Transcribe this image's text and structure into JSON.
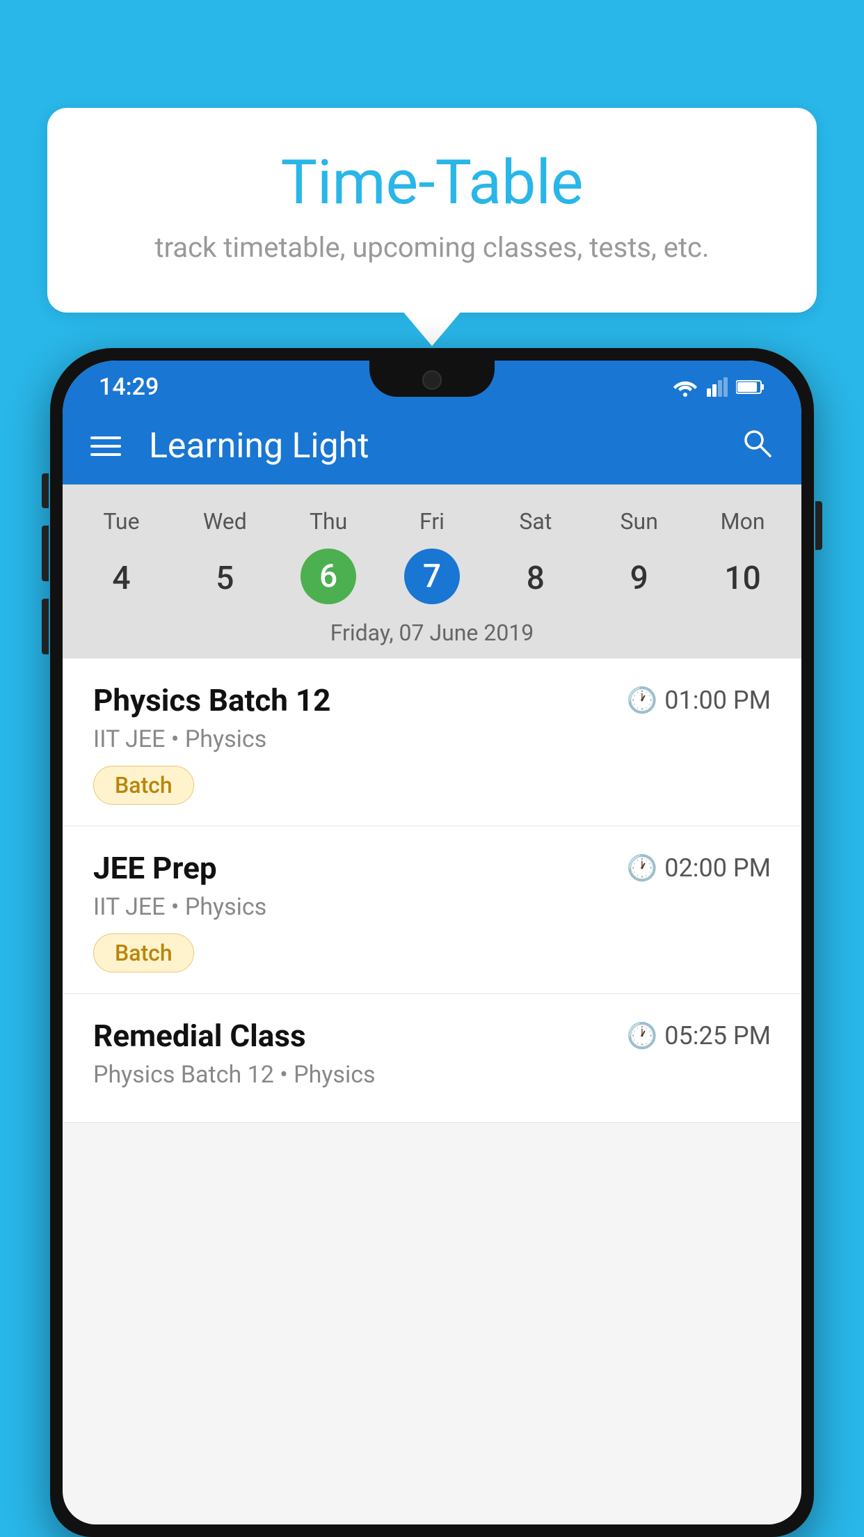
{
  "background_color": "#29b6e8",
  "tooltip": {
    "title": "Time-Table",
    "subtitle": "track timetable, upcoming classes, tests, etc."
  },
  "phone": {
    "status_bar": {
      "time": "14:29"
    },
    "app_bar": {
      "title": "Learning Light"
    },
    "calendar": {
      "days": [
        "Tue",
        "Wed",
        "Thu",
        "Fri",
        "Sat",
        "Sun",
        "Mon"
      ],
      "dates": [
        "4",
        "5",
        "6",
        "7",
        "8",
        "9",
        "10"
      ],
      "today_index": 2,
      "selected_index": 3,
      "selected_label": "Friday, 07 June 2019"
    },
    "schedule": [
      {
        "name": "Physics Batch 12",
        "time": "01:00 PM",
        "meta": "IIT JEE • Physics",
        "badge": "Batch"
      },
      {
        "name": "JEE Prep",
        "time": "02:00 PM",
        "meta": "IIT JEE • Physics",
        "badge": "Batch"
      },
      {
        "name": "Remedial Class",
        "time": "05:25 PM",
        "meta": "Physics Batch 12 • Physics",
        "badge": ""
      }
    ]
  }
}
